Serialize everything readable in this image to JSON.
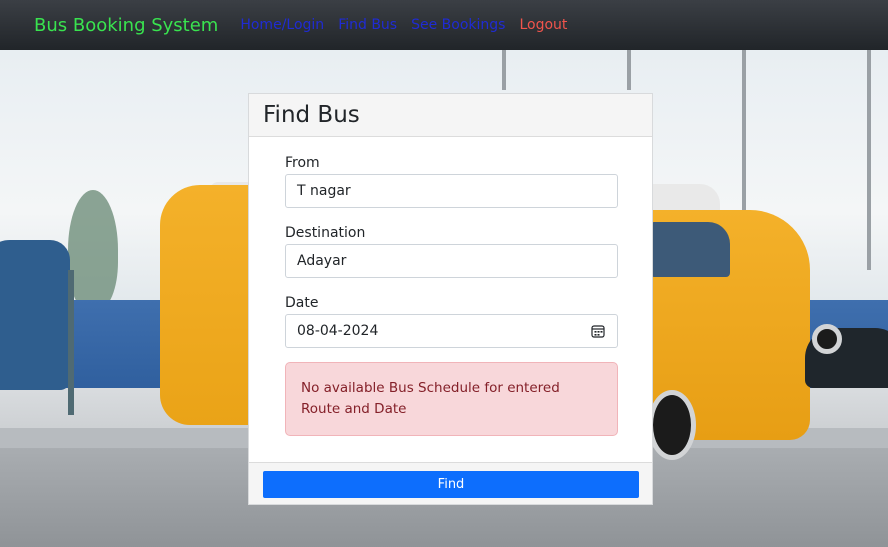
{
  "navbar": {
    "brand": "Bus Booking System",
    "links": [
      {
        "label": "Home/Login"
      },
      {
        "label": "Find Bus"
      },
      {
        "label": "See Bookings"
      },
      {
        "label": "Logout"
      }
    ]
  },
  "card": {
    "title": "Find Bus",
    "from": {
      "label": "From",
      "value": "T nagar"
    },
    "destination": {
      "label": "Destination",
      "value": "Adayar"
    },
    "date": {
      "label": "Date",
      "value": "08-04-2024",
      "icon": "calendar-icon"
    },
    "alert": "No available Bus Schedule for entered Route and Date",
    "find_button": "Find"
  },
  "colors": {
    "brand": "#39e34f",
    "nav_link": "#1f2bd4",
    "logout": "#f0544c",
    "primary": "#0d6efd",
    "alert_bg": "#f8d7da",
    "alert_text": "#842029"
  }
}
